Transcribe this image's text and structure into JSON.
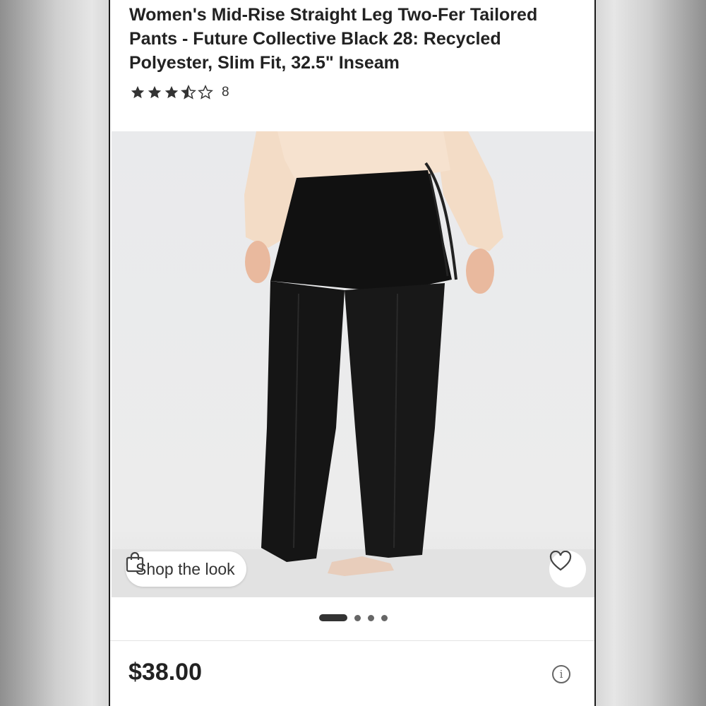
{
  "product": {
    "title": "Women's Mid-Rise Straight Leg Two-Fer Tailored Pants - Future Collective Black 28: Recycled Polyester, Slim Fit, 32.5\" Inseam",
    "rating": 3.5,
    "rating_max": 5,
    "review_count": "8",
    "price": "$38.00"
  },
  "gallery": {
    "shop_the_look_label": "Shop the look",
    "current_index": 1,
    "image_count": 4
  },
  "icons": {
    "bag": "shopping-bag-icon",
    "heart": "heart-icon",
    "info": "info-icon",
    "star": "star-icon"
  },
  "colors": {
    "text": "#222222",
    "star": "#333333",
    "blouse": "#f3dcc6",
    "pants": "#141414"
  }
}
